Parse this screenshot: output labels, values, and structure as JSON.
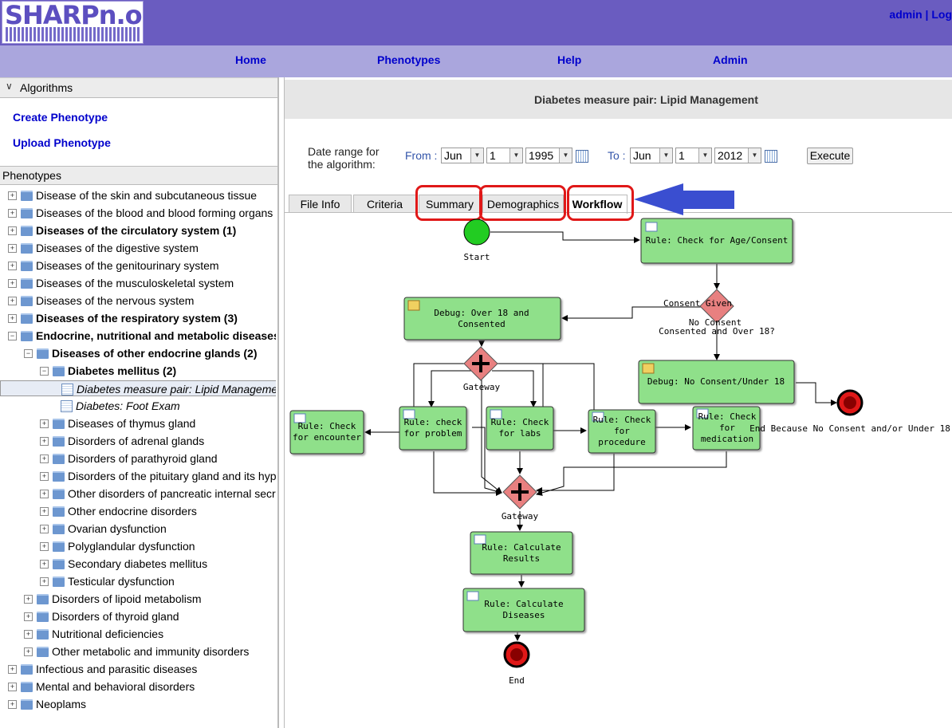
{
  "header": {
    "logo": "SHARPn.org",
    "user": "admin",
    "separator": "|",
    "logout_partial": "Log"
  },
  "nav": {
    "home": "Home",
    "phenotypes": "Phenotypes",
    "help": "Help",
    "admin": "Admin"
  },
  "sidebar": {
    "algorithms_header": "Algorithms",
    "create": "Create Phenotype",
    "upload": "Upload Phenotype",
    "phenotypes_header": "Phenotypes",
    "tree": [
      {
        "label": "Disease of the skin and subcutaneous tissue",
        "level": 0,
        "type": "folder",
        "bold": false,
        "toggle": "+"
      },
      {
        "label": "Diseases of the blood and blood forming organs",
        "level": 0,
        "type": "folder",
        "bold": false,
        "toggle": "+"
      },
      {
        "label": "Diseases of the circulatory system (1)",
        "level": 0,
        "type": "folder",
        "bold": true,
        "toggle": "+"
      },
      {
        "label": "Diseases of the digestive system",
        "level": 0,
        "type": "folder",
        "bold": false,
        "toggle": "+"
      },
      {
        "label": "Diseases of the genitourinary system",
        "level": 0,
        "type": "folder",
        "bold": false,
        "toggle": "+"
      },
      {
        "label": "Diseases of the musculoskeletal system",
        "level": 0,
        "type": "folder",
        "bold": false,
        "toggle": "+"
      },
      {
        "label": "Diseases of the nervous system",
        "level": 0,
        "type": "folder",
        "bold": false,
        "toggle": "+"
      },
      {
        "label": "Diseases of the respiratory system (3)",
        "level": 0,
        "type": "folder",
        "bold": true,
        "toggle": "+"
      },
      {
        "label": "Endocrine, nutritional and metabolic diseases",
        "level": 0,
        "type": "folder",
        "bold": true,
        "toggle": "−"
      },
      {
        "label": "Diseases of other endocrine glands (2)",
        "level": 1,
        "type": "folder",
        "bold": true,
        "toggle": "−"
      },
      {
        "label": "Diabetes mellitus (2)",
        "level": 2,
        "type": "folder",
        "bold": true,
        "toggle": "−"
      },
      {
        "label": "Diabetes measure pair: Lipid Management",
        "level": 3,
        "type": "doc",
        "italic": true,
        "selected": true
      },
      {
        "label": "Diabetes: Foot Exam",
        "level": 3,
        "type": "doc",
        "italic": true
      },
      {
        "label": "Diseases of thymus gland",
        "level": 2,
        "type": "folder",
        "toggle": "+"
      },
      {
        "label": "Disorders of adrenal glands",
        "level": 2,
        "type": "folder",
        "toggle": "+"
      },
      {
        "label": "Disorders of parathyroid gland",
        "level": 2,
        "type": "folder",
        "toggle": "+"
      },
      {
        "label": "Disorders of the pituitary gland and its hypofunction",
        "level": 2,
        "type": "folder",
        "toggle": "+"
      },
      {
        "label": "Other disorders of pancreatic internal secretion",
        "level": 2,
        "type": "folder",
        "toggle": "+"
      },
      {
        "label": "Other endocrine disorders",
        "level": 2,
        "type": "folder",
        "toggle": "+"
      },
      {
        "label": "Ovarian dysfunction",
        "level": 2,
        "type": "folder",
        "toggle": "+"
      },
      {
        "label": "Polyglandular dysfunction",
        "level": 2,
        "type": "folder",
        "toggle": "+"
      },
      {
        "label": "Secondary diabetes mellitus",
        "level": 2,
        "type": "folder",
        "toggle": "+"
      },
      {
        "label": "Testicular dysfunction",
        "level": 2,
        "type": "folder",
        "toggle": "+"
      },
      {
        "label": "Disorders of lipoid metabolism",
        "level": 1,
        "type": "folder",
        "toggle": "+"
      },
      {
        "label": "Disorders of thyroid gland",
        "level": 1,
        "type": "folder",
        "toggle": "+"
      },
      {
        "label": "Nutritional deficiencies",
        "level": 1,
        "type": "folder",
        "toggle": "+"
      },
      {
        "label": "Other metabolic and immunity disorders",
        "level": 1,
        "type": "folder",
        "toggle": "+"
      },
      {
        "label": "Infectious and parasitic diseases",
        "level": 0,
        "type": "folder",
        "toggle": "+"
      },
      {
        "label": "Mental and behavioral disorders",
        "level": 0,
        "type": "folder",
        "toggle": "+"
      },
      {
        "label": "Neoplams",
        "level": 0,
        "type": "folder",
        "toggle": "+"
      }
    ]
  },
  "main": {
    "title": "Diabetes measure pair: Lipid Management",
    "date_range_label_1": "Date range for",
    "date_range_label_2": "the algorithm:",
    "from_label": "From :",
    "to_label": "To :",
    "from": {
      "month": "Jun",
      "day": "1",
      "year": "1995"
    },
    "to": {
      "month": "Jun",
      "day": "1",
      "year": "2012"
    },
    "execute": "Execute",
    "tabs": [
      "File Info",
      "Criteria",
      "Summary",
      "Demographics",
      "Workflow"
    ],
    "active_tab": "Workflow"
  },
  "workflow": {
    "start": "Start",
    "end": "End",
    "end_alt": "End Because No Consent and/or Under 18",
    "gateway": "Gateway",
    "consent_given": "Consent Given",
    "no_consent": "No Consent",
    "decision": "Consented and Over 18?",
    "check_age": "Rule: Check for Age/Consent",
    "debug_over18_1": "Debug: Over 18 and",
    "debug_over18_2": "Consented",
    "debug_noconsent": "Debug: No Consent/Under 18",
    "encounter_1": "Rule: Check",
    "encounter_2": "for encounter",
    "problem_1": "Rule: check",
    "problem_2": "for problem",
    "labs_1": "Rule: Check",
    "labs_2": "for labs",
    "procedure_1": "Rule: Check",
    "procedure_2": "for",
    "procedure_3": "procedure",
    "medication_1": "Rule: Check",
    "medication_2": "for",
    "medication_3": "medication",
    "calc_results_1": "Rule: Calculate",
    "calc_results_2": "Results",
    "calc_diseases_1": "Rule: Calculate",
    "calc_diseases_2": "Diseases"
  },
  "colors": {
    "header": "#6a5cc0",
    "nav": "#aaa6dd",
    "task": "#8fe08a",
    "gateway": "#e88080",
    "highlight": "#e01818",
    "arrow": "#3a4ed0"
  }
}
